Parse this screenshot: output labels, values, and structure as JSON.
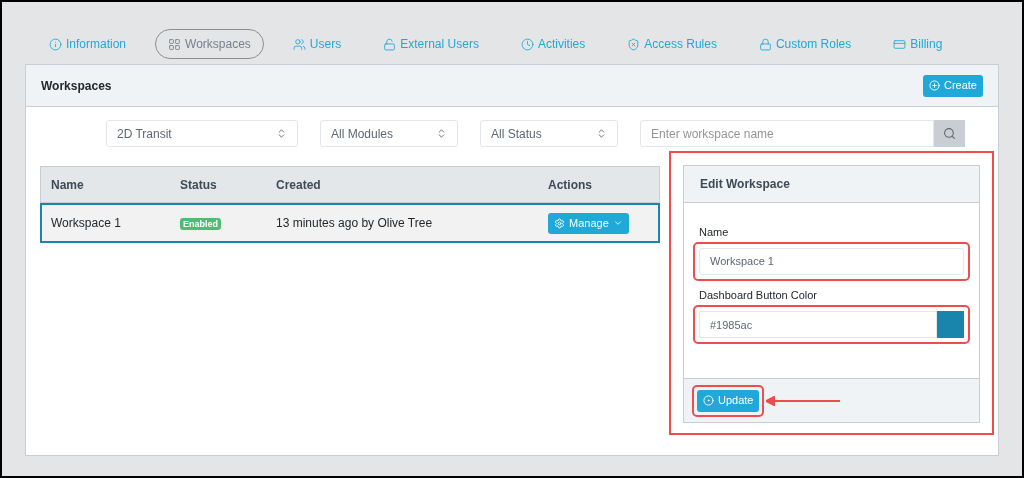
{
  "tabs": [
    {
      "label": "Information",
      "selected": false
    },
    {
      "label": "Workspaces",
      "selected": true
    },
    {
      "label": "Users",
      "selected": false
    },
    {
      "label": "External Users",
      "selected": false
    },
    {
      "label": "Activities",
      "selected": false
    },
    {
      "label": "Access Rules",
      "selected": false
    },
    {
      "label": "Custom Roles",
      "selected": false
    },
    {
      "label": "Billing",
      "selected": false
    }
  ],
  "card": {
    "title": "Workspaces",
    "create_button": "Create"
  },
  "filters": {
    "selects": [
      "2D Transit",
      "All Modules",
      "All Status"
    ],
    "search": {
      "placeholder": "Enter workspace name"
    }
  },
  "table": {
    "columns": [
      "Name",
      "Status",
      "Created",
      "Actions"
    ],
    "rows": [
      {
        "name": "Workspace 1",
        "status": "Enabled",
        "created": "13 minutes ago by Olive Tree",
        "action": "Manage",
        "selected": true
      }
    ]
  },
  "edit_panel": {
    "title": "Edit Workspace",
    "name_label": "Name",
    "name_value": "Workspace 1",
    "color_label": "Dashboard Button Color",
    "color_value": "#1985ac",
    "update_button": "Update"
  }
}
